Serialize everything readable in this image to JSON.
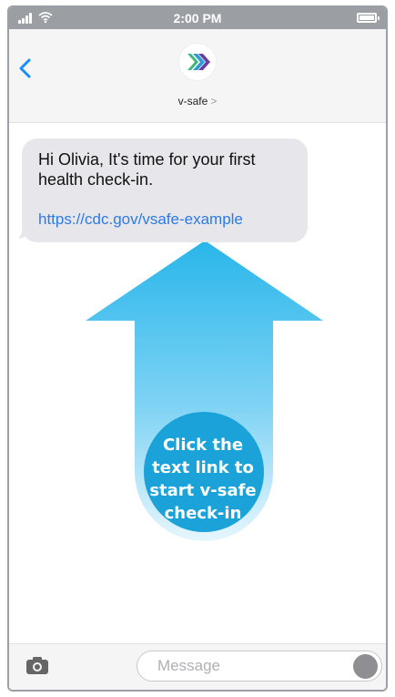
{
  "status_bar": {
    "time": "2:00 PM",
    "signal_icon": "signal-bars-icon",
    "wifi_icon": "wifi-icon",
    "battery_icon": "battery-icon"
  },
  "header": {
    "back_icon": "chevron-left-icon",
    "contact_name": "v-safe",
    "contact_chevron": ">",
    "logo_icon": "v-safe-logo"
  },
  "message": {
    "greeting_prefix": "Hi",
    "name": "Olivia,",
    "text": "It's time for your first health check-in.",
    "link": "https://cdc.gov/vsafe-example"
  },
  "callout": {
    "lines": [
      "Click the",
      "text link to",
      "start v-safe",
      "check-in"
    ],
    "arrow_icon": "up-arrow-icon",
    "colors": {
      "arrow_top": "#29b6ea",
      "arrow_bottom": "#e6f6fd",
      "circle": "#1aa2d9"
    }
  },
  "input_bar": {
    "camera_icon": "camera-icon",
    "placeholder": "Message",
    "send_icon": "send-circle-icon"
  },
  "colors": {
    "status_bar": "#9b9fa4",
    "header_bg": "#f5f5f6",
    "bubble_bg": "#e6e6eb",
    "link": "#2c7be5",
    "accent": "#1a8cff"
  }
}
